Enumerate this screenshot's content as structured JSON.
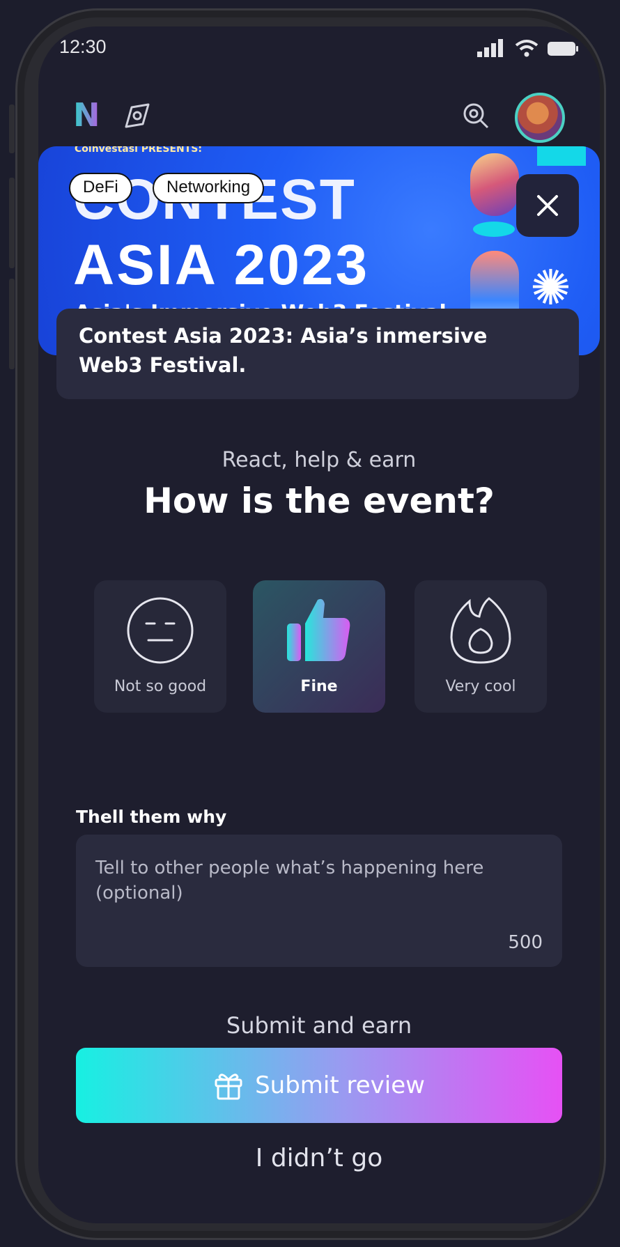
{
  "status": {
    "time": "12:30"
  },
  "header": {
    "logo": "N"
  },
  "banner": {
    "small_text": "Coinvestasi PRESENTS:",
    "line1": "CONTEST",
    "line2": "ASIA 2023",
    "subtitle": "Asia's Immersive Web3 Festival"
  },
  "tags": [
    "DeFi",
    "Networking"
  ],
  "event": {
    "title": "Contest Asia 2023: Asia’s inmersive Web3 Festival."
  },
  "prompt": {
    "eyebrow": "React, help & earn",
    "question": "How is the event?"
  },
  "reactions": [
    {
      "label": "Not so good",
      "icon": "meh-face-icon",
      "selected": false
    },
    {
      "label": "Fine",
      "icon": "thumbs-up-icon",
      "selected": true
    },
    {
      "label": "Very cool",
      "icon": "fire-icon",
      "selected": false
    }
  ],
  "review": {
    "label": "Thell them why",
    "placeholder": "Tell to other people what’s happening here (optional)",
    "char_limit": "500"
  },
  "actions": {
    "caption": "Submit and earn",
    "submit_label": "Submit review",
    "skip_label": "I didn’t go"
  },
  "colors": {
    "background": "#1e1e2e",
    "banner": "#1f5df5",
    "gradient_start": "#17f0e2",
    "gradient_end": "#e651f4"
  }
}
